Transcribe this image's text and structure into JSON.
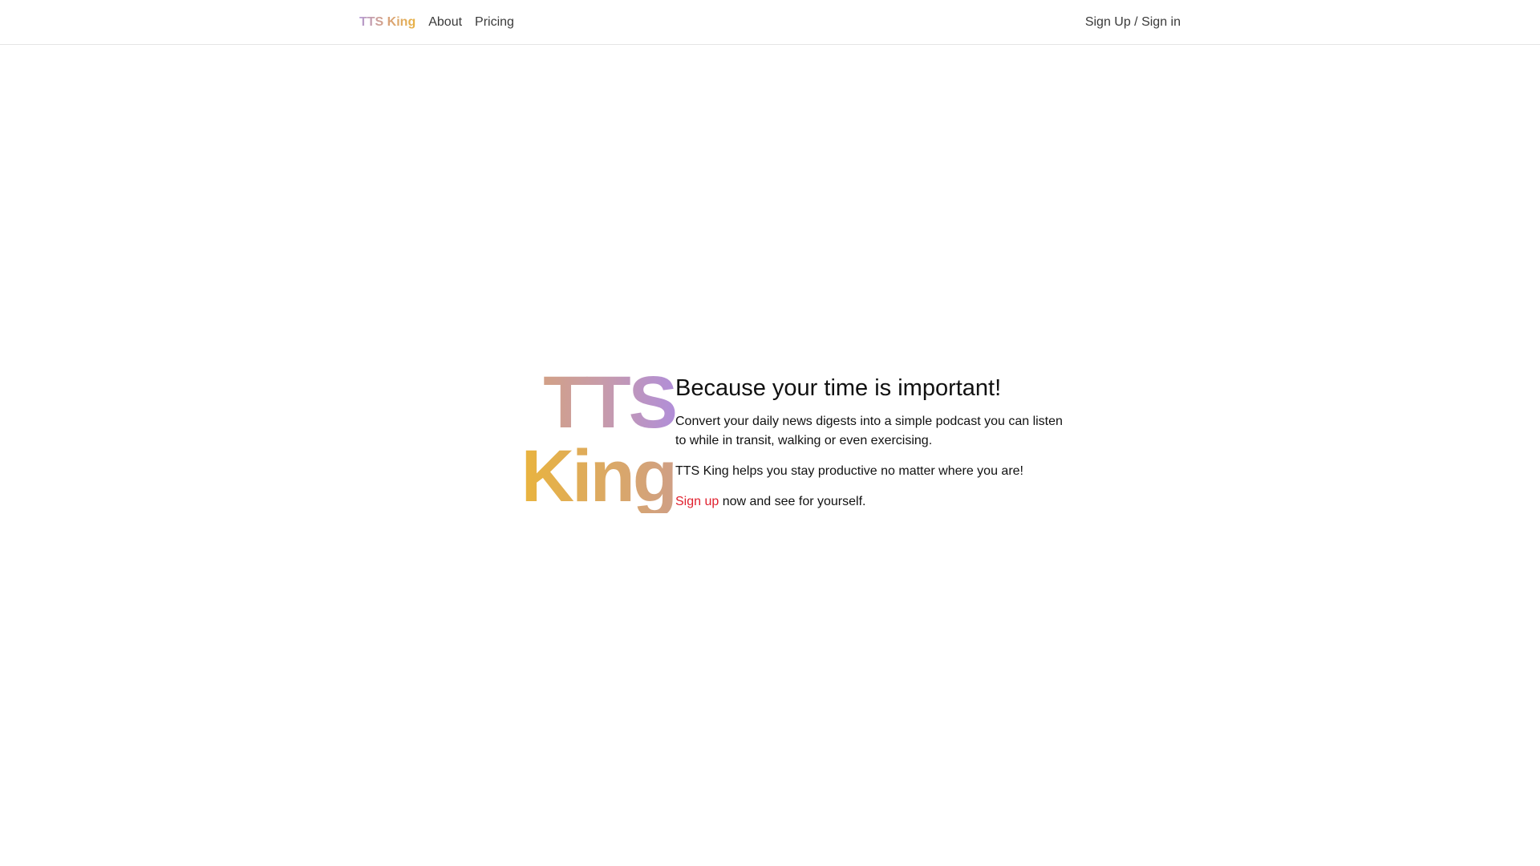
{
  "navbar": {
    "brand": "TTS King",
    "links": [
      {
        "label": "About"
      },
      {
        "label": "Pricing"
      }
    ],
    "auth_label": "Sign Up / Sign in"
  },
  "hero": {
    "logo_line1": "TTS",
    "logo_line2": "King",
    "heading": "Because your time is important!",
    "paragraph1": "Convert your daily news digests into a simple podcast you can listen to while in transit, walking or even exercising.",
    "paragraph2": "TTS King helps you stay productive no matter where you are!",
    "cta_link": "Sign up",
    "cta_rest": " now and see for yourself."
  },
  "colors": {
    "link_red": "#e0202e",
    "gradient_purple": "#b18ed8",
    "gradient_gold": "#e9b43e",
    "gradient_tan": "#d6a27a"
  }
}
